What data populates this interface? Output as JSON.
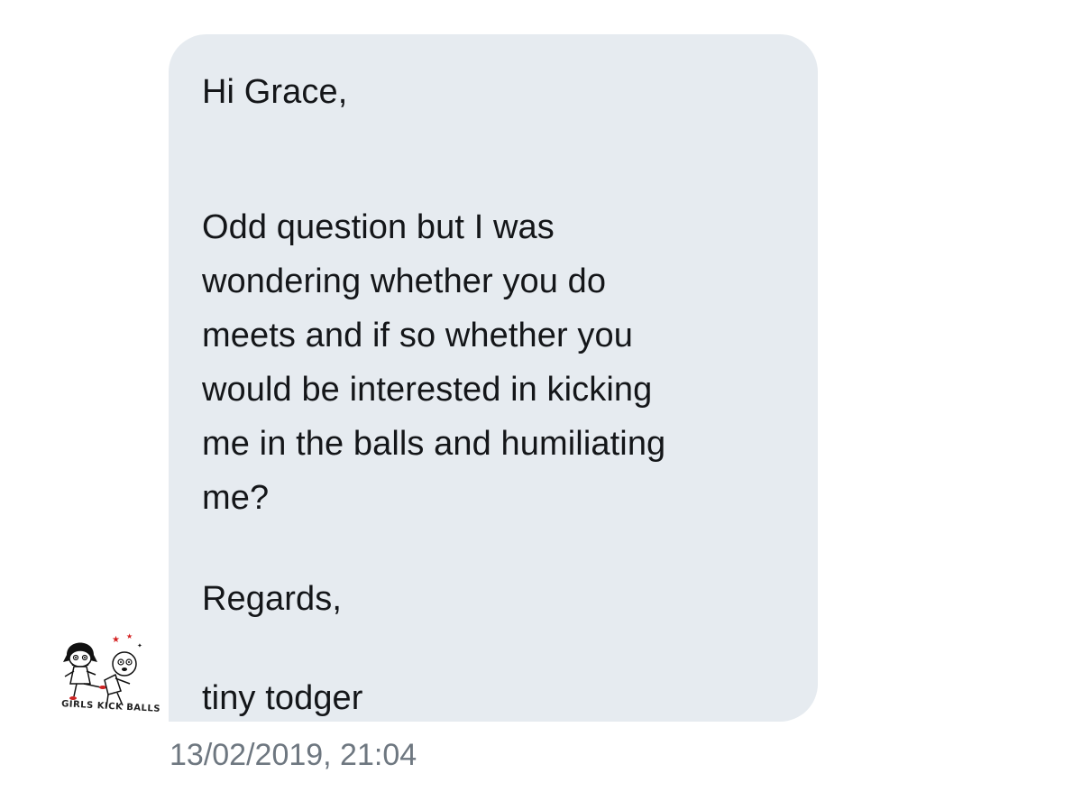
{
  "conversation": {
    "message": {
      "lines": [
        "Hi Grace,",
        "Odd question but I was",
        "wondering whether you do",
        "meets and if so whether you",
        "would be interested in kicking",
        "me in the balls and humiliating",
        "me?",
        "Regards,",
        "tiny todger"
      ],
      "timestamp": "13/02/2019, 21:04"
    },
    "sender": {
      "avatar_caption": "GIRLS KICK BALLS",
      "avatar_icon": "cartoon-girl-kicking-icon"
    }
  },
  "colors": {
    "bubble_bg": "#e6ebf0",
    "message_text": "#141619",
    "timestamp_text": "#6e7780",
    "avatar_star": "#d42020"
  }
}
